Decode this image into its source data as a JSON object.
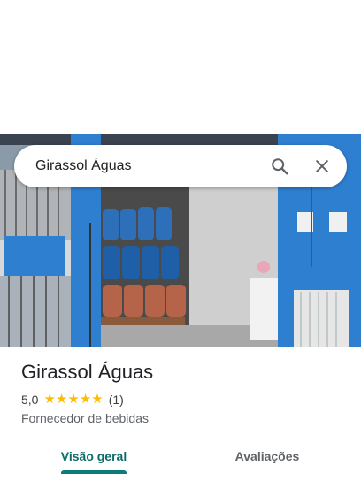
{
  "search": {
    "query": "Girassol Águas"
  },
  "place": {
    "name": "Girassol Águas",
    "rating": "5,0",
    "stars": 5,
    "review_count": "(1)",
    "category": "Fornecedor de bebidas"
  },
  "tabs": [
    {
      "label": "Visão geral",
      "active": true
    },
    {
      "label": "Avaliações",
      "active": false
    }
  ],
  "colors": {
    "accent": "#0b7c78",
    "star": "#fbbc04",
    "wall_blue": "#2f7fd1"
  },
  "icons": [
    "search-icon",
    "close-icon",
    "star-icon"
  ]
}
